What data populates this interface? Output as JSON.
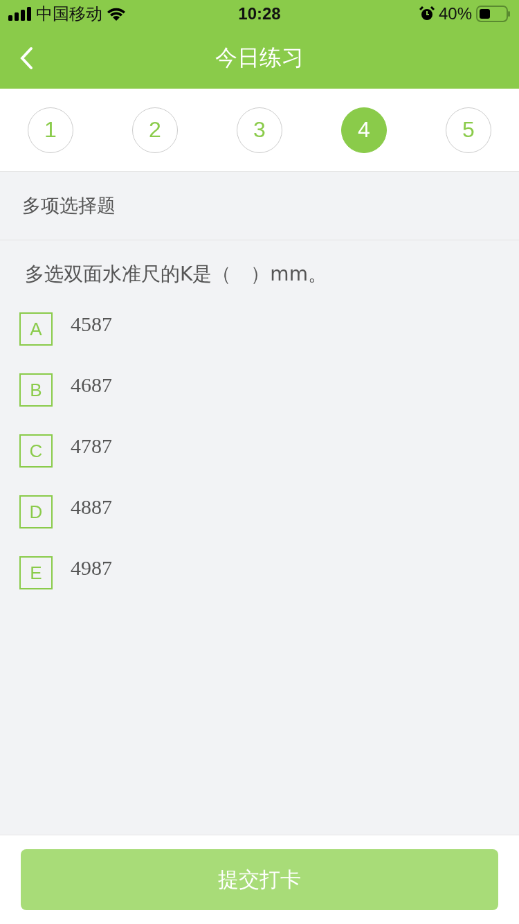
{
  "status_bar": {
    "carrier": "中国移动",
    "time": "10:28",
    "battery": "40%"
  },
  "nav": {
    "title": "今日练习"
  },
  "question_numbers": [
    {
      "label": "1",
      "selected": false
    },
    {
      "label": "2",
      "selected": false
    },
    {
      "label": "3",
      "selected": false
    },
    {
      "label": "4",
      "selected": true
    },
    {
      "label": "5",
      "selected": false
    }
  ],
  "question_type": "多项选择题",
  "question": "多选双面水准尺的K是（　）mm。",
  "options": [
    {
      "letter": "A",
      "text": "4587",
      "selected": false
    },
    {
      "letter": "B",
      "text": "4687",
      "selected": false
    },
    {
      "letter": "C",
      "text": "4787",
      "selected": false
    },
    {
      "letter": "D",
      "text": "4887",
      "selected": false
    },
    {
      "letter": "E",
      "text": "4987",
      "selected": false
    }
  ],
  "submit_button": "提交打卡"
}
